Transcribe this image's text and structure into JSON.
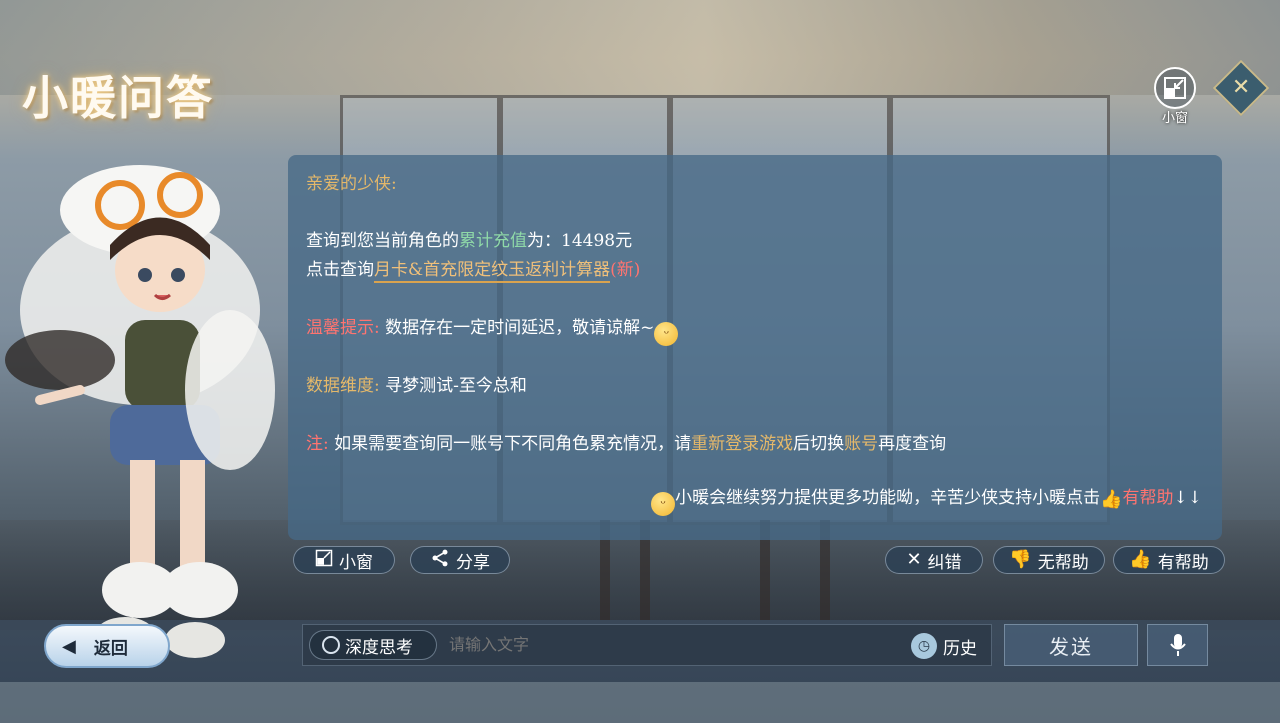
{
  "header": {
    "title": "小暖问答",
    "mini_window_label": "小窗",
    "close_icon": "close-icon"
  },
  "message": {
    "greeting": "亲爱的少侠:",
    "query_prefix": "查询到您当前角色的",
    "query_highlight": "累计充值",
    "query_suffix": "为：14498元",
    "calc_prefix": "点击查询",
    "calc_link": "月卡&首充限定纹玉返利计算器",
    "calc_new": "(新)",
    "tip_label": "温馨提示:",
    "tip_text": " 数据存在一定时间延迟，敬请谅解~",
    "dimension_label": "数据维度:",
    "dimension_text": " 寻梦测试-至今总和",
    "note_label": "注:",
    "note_text_1": " 如果需要查询同一账号下不同角色累充情况，请",
    "note_highlight_1": "重新登录游戏",
    "note_text_2": "后切换",
    "note_highlight_2": "账号",
    "note_text_3": "再度查询",
    "footer_text": "小暖会继续努力提供更多功能呦，辛苦少侠支持小暖点击",
    "footer_helpful": "有帮助",
    "footer_arrows": "↓↓"
  },
  "actions": {
    "mini_window": "小窗",
    "share": "分享",
    "correct": "纠错",
    "not_helpful": "无帮助",
    "helpful": "有帮助"
  },
  "bottom": {
    "back": "返回",
    "deep_think": "深度思考",
    "input_placeholder": "请输入文字",
    "history": "历史",
    "send": "发送"
  },
  "colors": {
    "panel": "#46698780",
    "gold": "#e4b86a",
    "green": "#8fd9a8",
    "red": "#ff7470"
  }
}
